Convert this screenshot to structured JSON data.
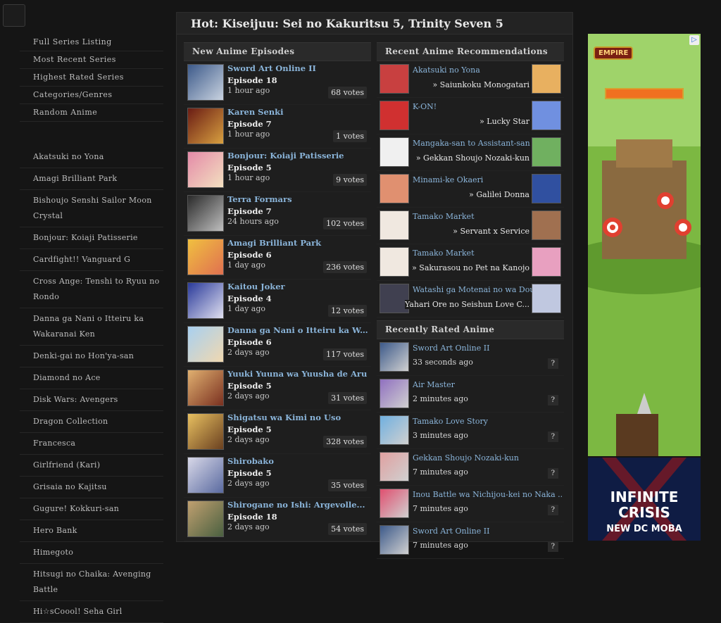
{
  "sidebar": {
    "links": [
      "Full Series Listing",
      "Most Recent Series",
      "Highest Rated Series",
      "Categories/Genres",
      "Random Anime"
    ],
    "series": [
      "Akatsuki no Yona",
      "Amagi Brilliant Park",
      "Bishoujo Senshi Sailor Moon Crystal",
      "Bonjour: Koiaji Patisserie",
      "Cardfight!! Vanguard G",
      "Cross Ange: Tenshi to Ryuu no Rondo",
      "Danna ga Nani o Itteiru ka Wakaranai Ken",
      "Denki-gai no Hon'ya-san",
      "Diamond no Ace",
      "Disk Wars: Avengers",
      "Dragon Collection",
      "Francesca",
      "Girlfriend (Kari)",
      "Grisaia no Kajitsu",
      "Gugure! Kokkuri-san",
      "Hero Bank",
      "Himegoto",
      "Hitsugi no Chaika: Avenging Battle",
      "Hi☆sCoool! Seha Girl"
    ]
  },
  "hot": {
    "text": "Hot: Kiseijuu: Sei no Kakuritsu 5, Trinity Seven 5"
  },
  "new_episodes": {
    "heading": "New Anime Episodes",
    "items": [
      {
        "title": "Sword Art Online II",
        "episode": "Episode 18",
        "time": "1 hour ago",
        "votes": "68 votes",
        "c1": "#3d5a8a",
        "c2": "#c9d3e0"
      },
      {
        "title": "Karen Senki",
        "episode": "Episode 7",
        "time": "1 hour ago",
        "votes": "1 votes",
        "c1": "#6a1c14",
        "c2": "#d8a040"
      },
      {
        "title": "Bonjour: Koiaji Patisserie",
        "episode": "Episode 5",
        "time": "1 hour ago",
        "votes": "9 votes",
        "c1": "#e48aa8",
        "c2": "#f3e0c0"
      },
      {
        "title": "Terra Formars",
        "episode": "Episode 7",
        "time": "24 hours ago",
        "votes": "102 votes",
        "c1": "#2a2a2a",
        "c2": "#bfbfbf"
      },
      {
        "title": "Amagi Brilliant Park",
        "episode": "Episode 6",
        "time": "1 day ago",
        "votes": "236 votes",
        "c1": "#f0c040",
        "c2": "#e07050"
      },
      {
        "title": "Kaitou Joker",
        "episode": "Episode 4",
        "time": "1 day ago",
        "votes": "12 votes",
        "c1": "#2a3a9a",
        "c2": "#e0e0f0"
      },
      {
        "title": "Danna ga Nani o Itteiru ka W...",
        "episode": "Episode 6",
        "time": "2 days ago",
        "votes": "117 votes",
        "c1": "#a8d0f0",
        "c2": "#f0d8b0"
      },
      {
        "title": "Yuuki Yuuna wa Yuusha de Aru",
        "episode": "Episode 5",
        "time": "2 days ago",
        "votes": "31 votes",
        "c1": "#e0b070",
        "c2": "#7a3020"
      },
      {
        "title": "Shigatsu wa Kimi no Uso",
        "episode": "Episode 5",
        "time": "2 days ago",
        "votes": "328 votes",
        "c1": "#e8c060",
        "c2": "#6a4020"
      },
      {
        "title": "Shirobako",
        "episode": "Episode 5",
        "time": "2 days ago",
        "votes": "35 votes",
        "c1": "#d8d8e8",
        "c2": "#5a6aa0"
      },
      {
        "title": "Shirogane no Ishi: Argevolle...",
        "episode": "Episode 18",
        "time": "2 days ago",
        "votes": "54 votes",
        "c1": "#c0a070",
        "c2": "#4a6040"
      }
    ]
  },
  "recommendations": {
    "heading": "Recent Anime Recommendations",
    "items": [
      {
        "from": "Akatsuki no Yona",
        "to": "» Saiunkoku Monogatari",
        "c1": "#c84040",
        "c2": "#e8b060"
      },
      {
        "from": "K-ON!",
        "to": "» Lucky Star",
        "c1": "#d03030",
        "c2": "#7090e0"
      },
      {
        "from": "Mangaka-san to Assistant-san",
        "to": "» Gekkan Shoujo Nozaki-kun",
        "c1": "#f0f0f0",
        "c2": "#70b060"
      },
      {
        "from": "Minami-ke Okaeri",
        "to": "» Galilei Donna",
        "c1": "#e09070",
        "c2": "#3050a0"
      },
      {
        "from": "Tamako Market",
        "to": "» Servant x Service",
        "c1": "#f0e8e0",
        "c2": "#a07050"
      },
      {
        "from": "Tamako Market",
        "to": "» Sakurasou no Pet na Kanojo",
        "c1": "#f0e8e0",
        "c2": "#e8a0c0"
      },
      {
        "from": "Watashi ga Motenai no wa Dou",
        "to": "Yahari Ore no Seishun Love C...",
        "c1": "#404050",
        "c2": "#c0c8e0"
      }
    ]
  },
  "rated": {
    "heading": "Recently Rated Anime",
    "items": [
      {
        "name": "Sword Art Online II",
        "ago": "33 seconds ago",
        "q": "?",
        "c1": "#3d5a8a"
      },
      {
        "name": "Air Master",
        "ago": "2 minutes ago",
        "q": "?",
        "c1": "#9070c0"
      },
      {
        "name": "Tamako Love Story",
        "ago": "3 minutes ago",
        "q": "?",
        "c1": "#70b0e0"
      },
      {
        "name": "Gekkan Shoujo Nozaki-kun",
        "ago": "7 minutes ago",
        "q": "?",
        "c1": "#e0a0a0"
      },
      {
        "name": "Inou Battle wa Nichijou-kei no Naka ...",
        "ago": "7 minutes ago",
        "q": "?",
        "c1": "#e05070"
      },
      {
        "name": "Sword Art Online II",
        "ago": "7 minutes ago",
        "q": "?",
        "c1": "#3d5a8a"
      }
    ]
  },
  "ads": {
    "ad1_logo": "EMPIRE",
    "ad2_line1": "INFINITE",
    "ad2_line2": "CRISIS",
    "ad2_line3": "NEW DC MOBA"
  }
}
